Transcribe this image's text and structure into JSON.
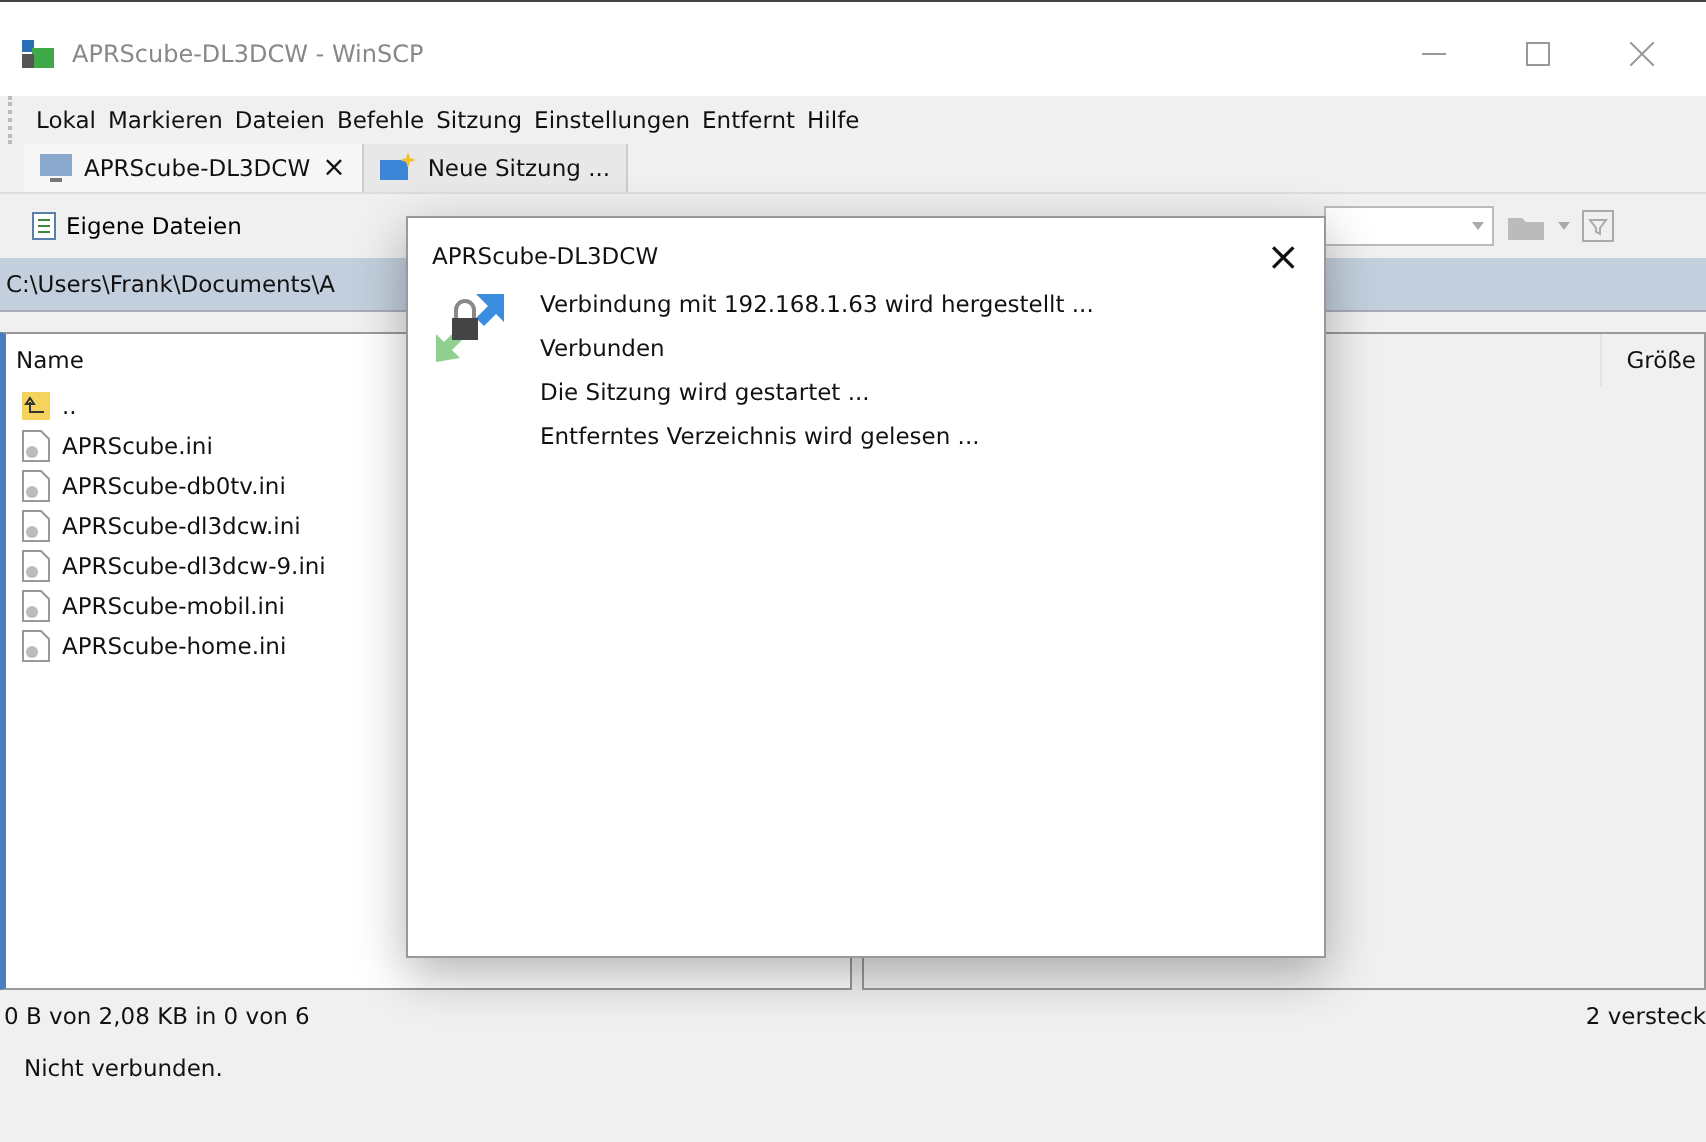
{
  "window": {
    "title": "APRScube-DL3DCW - WinSCP"
  },
  "menu": [
    "Lokal",
    "Markieren",
    "Dateien",
    "Befehle",
    "Sitzung",
    "Einstellungen",
    "Entfernt",
    "Hilfe"
  ],
  "tabs": [
    {
      "label": "APRScube-DL3DCW",
      "kind": "session",
      "selected": true,
      "close": "×"
    },
    {
      "label": "Neue Sitzung ...",
      "kind": "new",
      "selected": false
    }
  ],
  "local": {
    "toolbar_button": "Eigene Dateien",
    "path": "C:\\Users\\Frank\\Documents\\A",
    "column": "Name",
    "files": [
      {
        "name": "..",
        "kind": "up"
      },
      {
        "name": "APRScube.ini",
        "kind": "file"
      },
      {
        "name": "APRScube-db0tv.ini",
        "kind": "file"
      },
      {
        "name": "APRScube-dl3dcw.ini",
        "kind": "file"
      },
      {
        "name": "APRScube-dl3dcw-9.ini",
        "kind": "file"
      },
      {
        "name": "APRScube-mobil.ini",
        "kind": "file"
      },
      {
        "name": "APRScube-home.ini",
        "kind": "file"
      }
    ],
    "status": "0 B von 2,08 KB in 0 von 6"
  },
  "remote": {
    "column": "Größe",
    "status": "2 versteck"
  },
  "status_bar": "Nicht verbunden.",
  "dialog": {
    "title": "APRScube-DL3DCW",
    "close": "×",
    "messages": [
      "Verbindung mit 192.168.1.63 wird hergestellt ...",
      "Verbunden",
      "Die Sitzung wird gestartet ...",
      "Entferntes Verzeichnis wird gelesen ..."
    ]
  }
}
